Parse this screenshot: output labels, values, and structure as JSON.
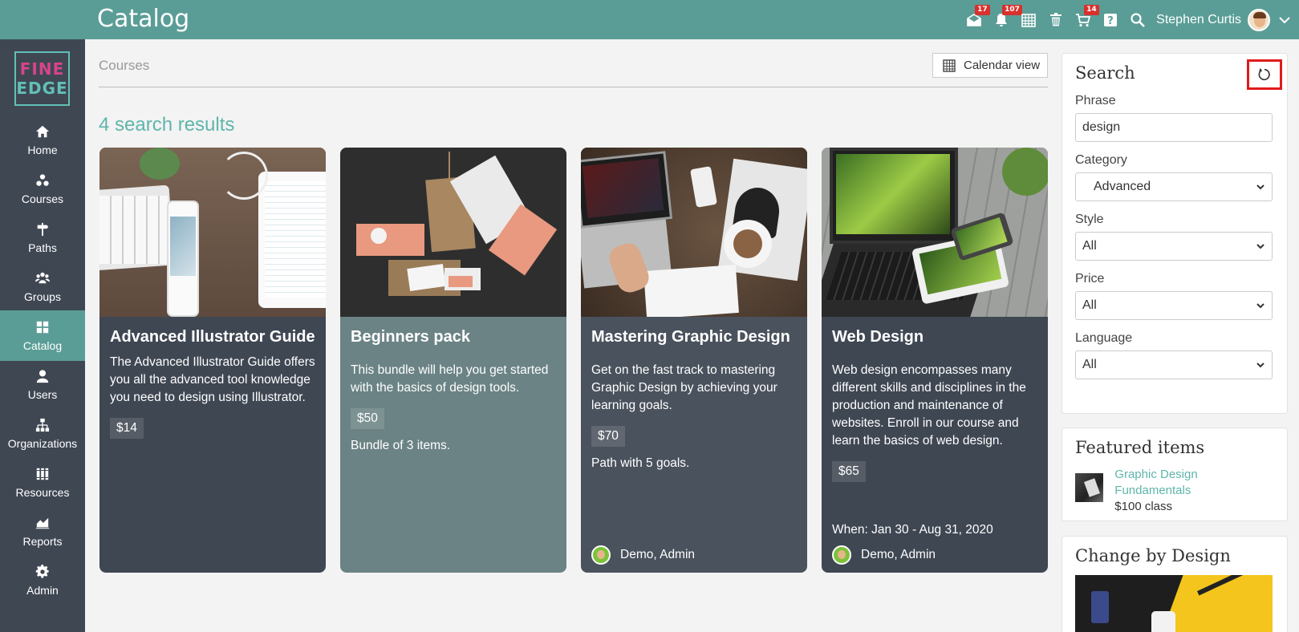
{
  "header": {
    "title": "Catalog",
    "user_name": "Stephen Curtis",
    "icons": [
      {
        "name": "messages-icon",
        "badge": "17"
      },
      {
        "name": "notifications-icon",
        "badge": "107"
      },
      {
        "name": "calendar-icon",
        "badge": ""
      },
      {
        "name": "trash-icon",
        "badge": ""
      },
      {
        "name": "cart-icon",
        "badge": "14"
      },
      {
        "name": "help-icon",
        "badge": ""
      },
      {
        "name": "search-icon",
        "badge": ""
      }
    ]
  },
  "logo": {
    "line1": "FINE",
    "line2": "EDGE"
  },
  "sidebar": {
    "items": [
      {
        "label": "Home",
        "icon": "home-icon"
      },
      {
        "label": "Courses",
        "icon": "courses-icon"
      },
      {
        "label": "Paths",
        "icon": "signpost-icon"
      },
      {
        "label": "Groups",
        "icon": "groups-icon"
      },
      {
        "label": "Catalog",
        "icon": "grid-icon",
        "active": true
      },
      {
        "label": "Users",
        "icon": "user-icon"
      },
      {
        "label": "Organizations",
        "icon": "org-chart-icon"
      },
      {
        "label": "Resources",
        "icon": "books-icon"
      },
      {
        "label": "Reports",
        "icon": "chart-icon"
      },
      {
        "label": "Admin",
        "icon": "gear-icon"
      }
    ]
  },
  "main": {
    "breadcrumb": "Courses",
    "calendar_button": "Calendar view",
    "results_title": "4 search results",
    "cards": [
      {
        "title": "Advanced Illustrator Guide",
        "description": "The Advanced Illustrator Guide offers you all the advanced tool knowledge you need to design using Illustrator.",
        "price": "$14",
        "extra": "",
        "when": "",
        "author": "",
        "bg": "#3f4753"
      },
      {
        "title": "Beginners pack",
        "description": "This bundle will help you get started with the basics of design tools.",
        "price": "$50",
        "extra": "Bundle of 3 items.",
        "when": "",
        "author": "",
        "bg": "#6b8385"
      },
      {
        "title": "Mastering Graphic Design",
        "description": "Get on the fast track to mastering Graphic Design by achieving your learning goals.",
        "price": "$70",
        "extra": "Path with 5 goals.",
        "when": "",
        "author": "Demo, Admin",
        "bg": "#4a525d"
      },
      {
        "title": "Web Design",
        "description": "Web design encompasses many different skills and disciplines in the production and maintenance of websites. Enroll in our course and learn the basics of web design.",
        "price": "$65",
        "extra": "",
        "when": "When: Jan 30 - Aug 31, 2020",
        "author": "Demo, Admin",
        "bg": "#3f4753"
      }
    ]
  },
  "search": {
    "title": "Search",
    "phrase_label": "Phrase",
    "phrase_value": "design",
    "category_label": "Category",
    "category_value": "Advanced",
    "style_label": "Style",
    "style_value": "All",
    "price_label": "Price",
    "price_value": "All",
    "language_label": "Language",
    "language_value": "All"
  },
  "featured": {
    "title": "Featured items",
    "item_link": "Graphic Design Fundamentals",
    "item_sub": "$100 class"
  },
  "change": {
    "title": "Change by Design"
  }
}
